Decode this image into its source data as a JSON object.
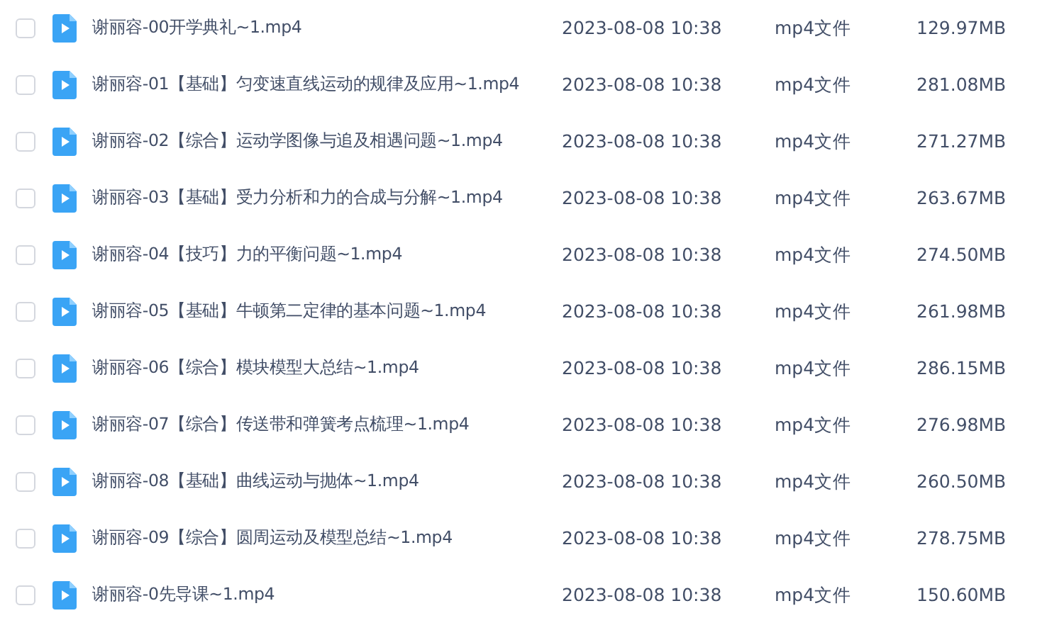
{
  "files": [
    {
      "name": "谢丽容-00开学典礼~1.mp4",
      "modified": "2023-08-08 10:38",
      "type": "mp4文件",
      "size": "129.97MB",
      "checked": false
    },
    {
      "name": "谢丽容-01【基础】匀变速直线运动的规律及应用~1.mp4",
      "modified": "2023-08-08 10:38",
      "type": "mp4文件",
      "size": "281.08MB",
      "checked": false
    },
    {
      "name": "谢丽容-02【综合】运动学图像与追及相遇问题~1.mp4",
      "modified": "2023-08-08 10:38",
      "type": "mp4文件",
      "size": "271.27MB",
      "checked": false
    },
    {
      "name": "谢丽容-03【基础】受力分析和力的合成与分解~1.mp4",
      "modified": "2023-08-08 10:38",
      "type": "mp4文件",
      "size": "263.67MB",
      "checked": false
    },
    {
      "name": "谢丽容-04【技巧】力的平衡问题~1.mp4",
      "modified": "2023-08-08 10:38",
      "type": "mp4文件",
      "size": "274.50MB",
      "checked": false
    },
    {
      "name": "谢丽容-05【基础】牛顿第二定律的基本问题~1.mp4",
      "modified": "2023-08-08 10:38",
      "type": "mp4文件",
      "size": "261.98MB",
      "checked": false
    },
    {
      "name": "谢丽容-06【综合】模块模型大总结~1.mp4",
      "modified": "2023-08-08 10:38",
      "type": "mp4文件",
      "size": "286.15MB",
      "checked": false
    },
    {
      "name": "谢丽容-07【综合】传送带和弹簧考点梳理~1.mp4",
      "modified": "2023-08-08 10:38",
      "type": "mp4文件",
      "size": "276.98MB",
      "checked": false
    },
    {
      "name": "谢丽容-08【基础】曲线运动与抛体~1.mp4",
      "modified": "2023-08-08 10:38",
      "type": "mp4文件",
      "size": "260.50MB",
      "checked": false
    },
    {
      "name": "谢丽容-09【综合】圆周运动及模型总结~1.mp4",
      "modified": "2023-08-08 10:38",
      "type": "mp4文件",
      "size": "278.75MB",
      "checked": false
    },
    {
      "name": "谢丽容-0先导课~1.mp4",
      "modified": "2023-08-08 10:38",
      "type": "mp4文件",
      "size": "150.60MB",
      "checked": false
    }
  ]
}
